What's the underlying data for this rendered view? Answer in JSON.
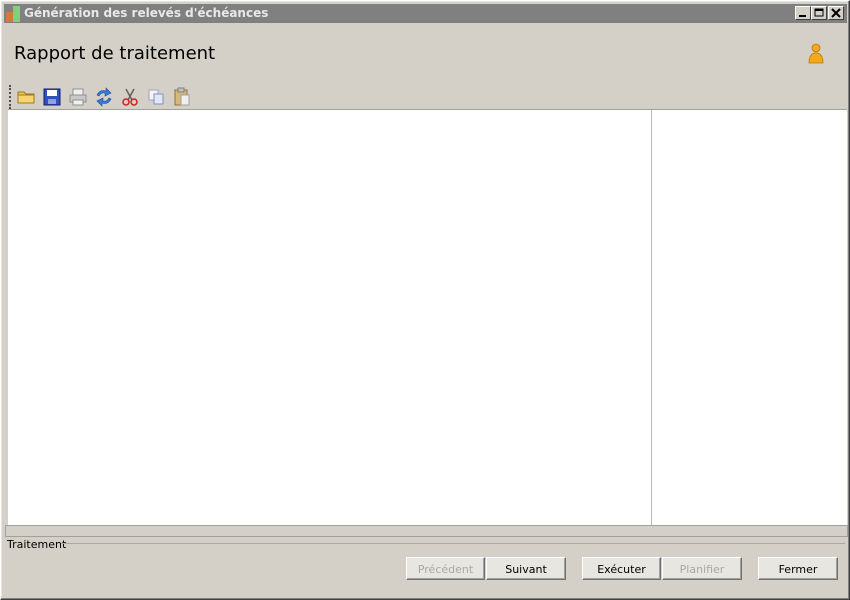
{
  "window": {
    "title": "Génération des relevés d'échéances",
    "controls": {
      "minimize": "_",
      "maximize": "□",
      "close": "✕"
    }
  },
  "header": {
    "title": "Rapport de traitement",
    "icon": "user-icon"
  },
  "toolbar": {
    "items": [
      {
        "name": "open-folder-icon",
        "enabled": true
      },
      {
        "name": "save-icon",
        "enabled": true
      },
      {
        "name": "print-icon",
        "enabled": false
      },
      {
        "name": "refresh-icon",
        "enabled": true
      },
      {
        "name": "cut-icon",
        "enabled": true
      },
      {
        "name": "copy-icon",
        "enabled": false
      },
      {
        "name": "paste-icon",
        "enabled": false
      }
    ]
  },
  "group": {
    "label": "Traitement"
  },
  "buttons": {
    "previous": {
      "label": "Précédent",
      "enabled": false
    },
    "next": {
      "label": "Suivant",
      "enabled": true
    },
    "execute": {
      "label": "Exécuter",
      "enabled": true
    },
    "schedule": {
      "label": "Planifier",
      "enabled": false
    },
    "close": {
      "label": "Fermer",
      "enabled": true
    }
  }
}
